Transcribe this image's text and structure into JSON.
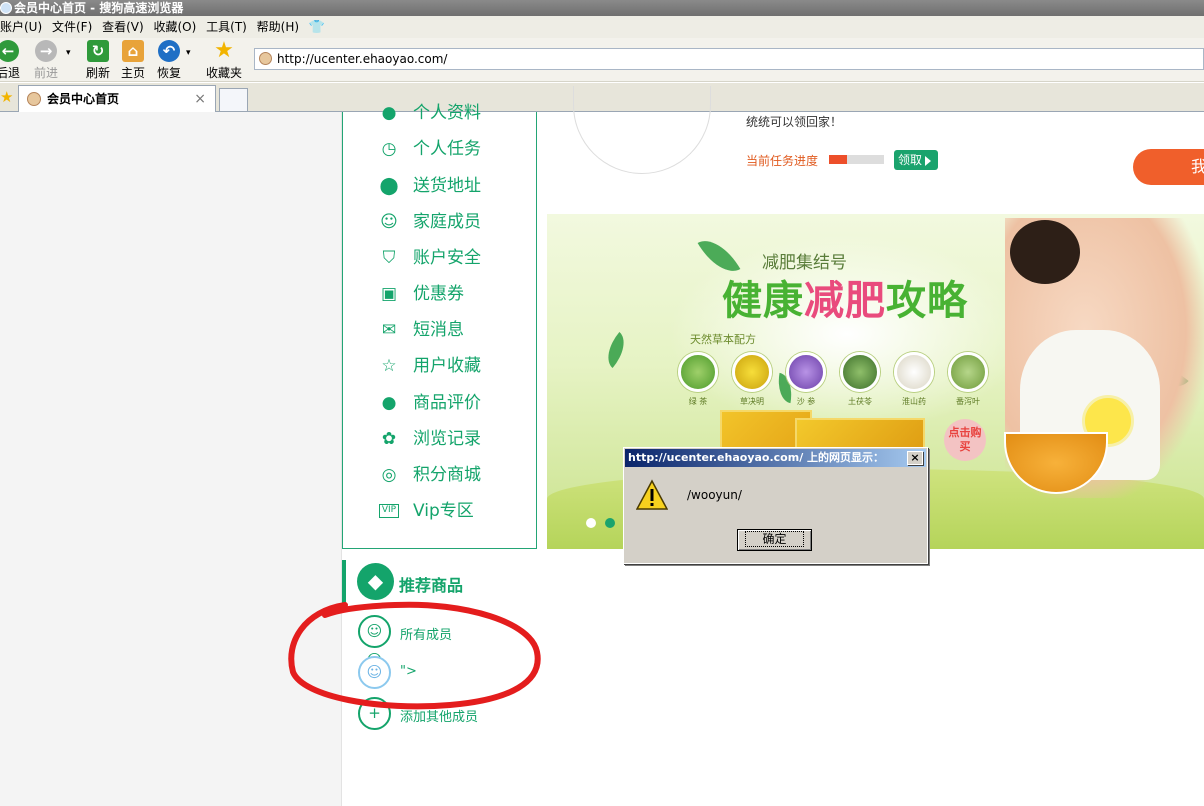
{
  "window": {
    "title": "会员中心首页 - 搜狗高速浏览器"
  },
  "menubar": [
    "账户(U)",
    "文件(F)",
    "查看(V)",
    "收藏(O)",
    "工具(T)",
    "帮助(H)"
  ],
  "toolbar": {
    "back": "后退",
    "forward": "前进",
    "refresh": "刷新",
    "home": "主页",
    "restore": "恢复",
    "favorites": "收藏夹"
  },
  "address": {
    "url": "http://ucenter.ehaoyao.com/"
  },
  "tabs": [
    {
      "label": "会员中心首页",
      "close": "×"
    }
  ],
  "sidebar": {
    "items": [
      {
        "label": "个人资料"
      },
      {
        "label": "个人任务",
        "icon": "task-icon"
      },
      {
        "label": "送货地址",
        "icon": "location-pin-icon"
      },
      {
        "label": "家庭成员",
        "icon": "family-icon"
      },
      {
        "label": "账户安全",
        "icon": "shield-icon"
      },
      {
        "label": "优惠券",
        "icon": "coupon-icon"
      },
      {
        "label": "短消息",
        "icon": "envelope-icon"
      },
      {
        "label": "用户收藏",
        "icon": "star-icon"
      },
      {
        "label": "商品评价",
        "icon": "comment-icon"
      },
      {
        "label": "浏览记录",
        "icon": "paw-icon"
      },
      {
        "label": "积分商城",
        "icon": "coins-icon"
      },
      {
        "label": "Vip专区",
        "icon": "vip-icon"
      }
    ]
  },
  "task": {
    "hint": "统统可以领回家！",
    "progress_label": "当前任务进度",
    "progress": 0.33,
    "claim_label": "领取",
    "orange_label": "我"
  },
  "banner": {
    "subtitle": "减肥集结号",
    "title_green_1": "健康",
    "title_pink": "减肥",
    "title_green_2": "攻略",
    "herb_caption": "天然草本配方",
    "herbs": [
      "绿 茶",
      "草决明",
      "沙 参",
      "土茯苓",
      "淮山药",
      "番泻叶"
    ],
    "buy_label": "点击购买",
    "slides": 2,
    "active_slide": 2
  },
  "recommended": {
    "title": "推荐商品",
    "members": [
      {
        "label": "所有成员"
      },
      {
        "label": "\">"
      },
      {
        "label": "添加其他成员"
      }
    ]
  },
  "dialog": {
    "title": "http://ucenter.ehaoyao.com/ 上的网页显示：",
    "message": "/wooyun/",
    "ok": "确定",
    "close": "×"
  },
  "colors": {
    "accent_green": "#14a46b",
    "progress_orange": "#ed4f2a",
    "highlight_pink": "#e94b7d",
    "annotation_red": "#e41d1d"
  }
}
